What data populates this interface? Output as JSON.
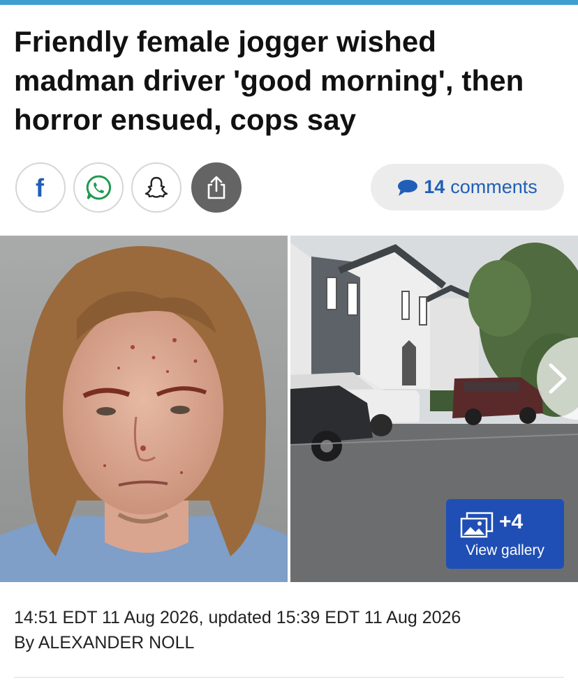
{
  "article": {
    "headline": "Friendly female jogger wished madman driver 'good morning', then horror ensued, cops say",
    "timestamp": "14:51 EDT 11 Aug 2026, updated 15:39 EDT 11 Aug 2026",
    "byline": "By ALEXANDER NOLL"
  },
  "share": {
    "buttons": [
      {
        "icon": "facebook-icon"
      },
      {
        "icon": "whatsapp-icon"
      },
      {
        "icon": "snapchat-icon"
      },
      {
        "icon": "share-icon"
      }
    ]
  },
  "comments": {
    "count": "14",
    "label": "comments",
    "icon": "speech-bubble-icon"
  },
  "gallery": {
    "extra_count": "+4",
    "label": "View gallery",
    "icon": "gallery-icon",
    "next_icon": "chevron-right-icon"
  },
  "colors": {
    "accent_bar": "#3f9fd0",
    "link_blue": "#1f5fb8",
    "gallery_button": "#1f4fb5"
  }
}
